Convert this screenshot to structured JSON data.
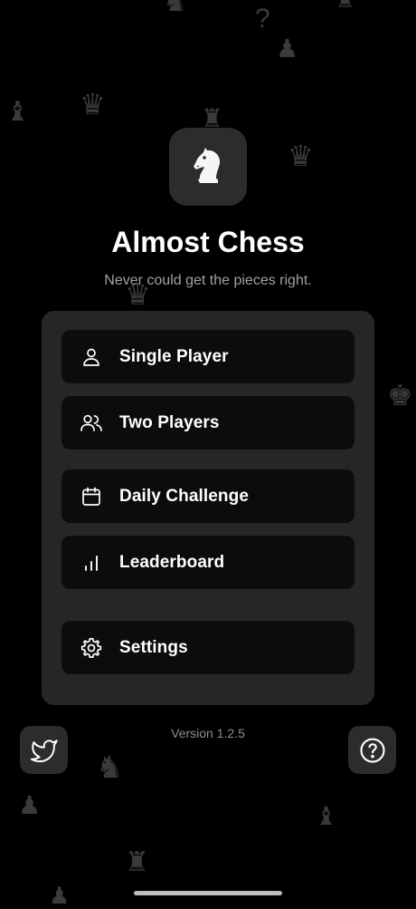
{
  "app": {
    "title": "Almost Chess",
    "tagline": "Never could get the pieces right.",
    "icon": "chess-knight-icon"
  },
  "menu": {
    "items": [
      {
        "label": "Single Player",
        "icon": "person-icon"
      },
      {
        "label": "Two Players",
        "icon": "two-people-icon"
      },
      {
        "label": "Daily Challenge",
        "icon": "calendar-icon"
      },
      {
        "label": "Leaderboard",
        "icon": "bar-chart-icon"
      },
      {
        "label": "Settings",
        "icon": "gear-icon"
      }
    ]
  },
  "footer": {
    "version": "Version 1.2.5",
    "left_button_icon": "twitter-icon",
    "right_button_icon": "help-icon"
  },
  "colors": {
    "background": "#000000",
    "panel": "#262628",
    "button": "#0c0c0d",
    "text_primary": "#ffffff",
    "text_secondary": "#a1a1a6",
    "decor_pieces": "#3a3a3c"
  }
}
